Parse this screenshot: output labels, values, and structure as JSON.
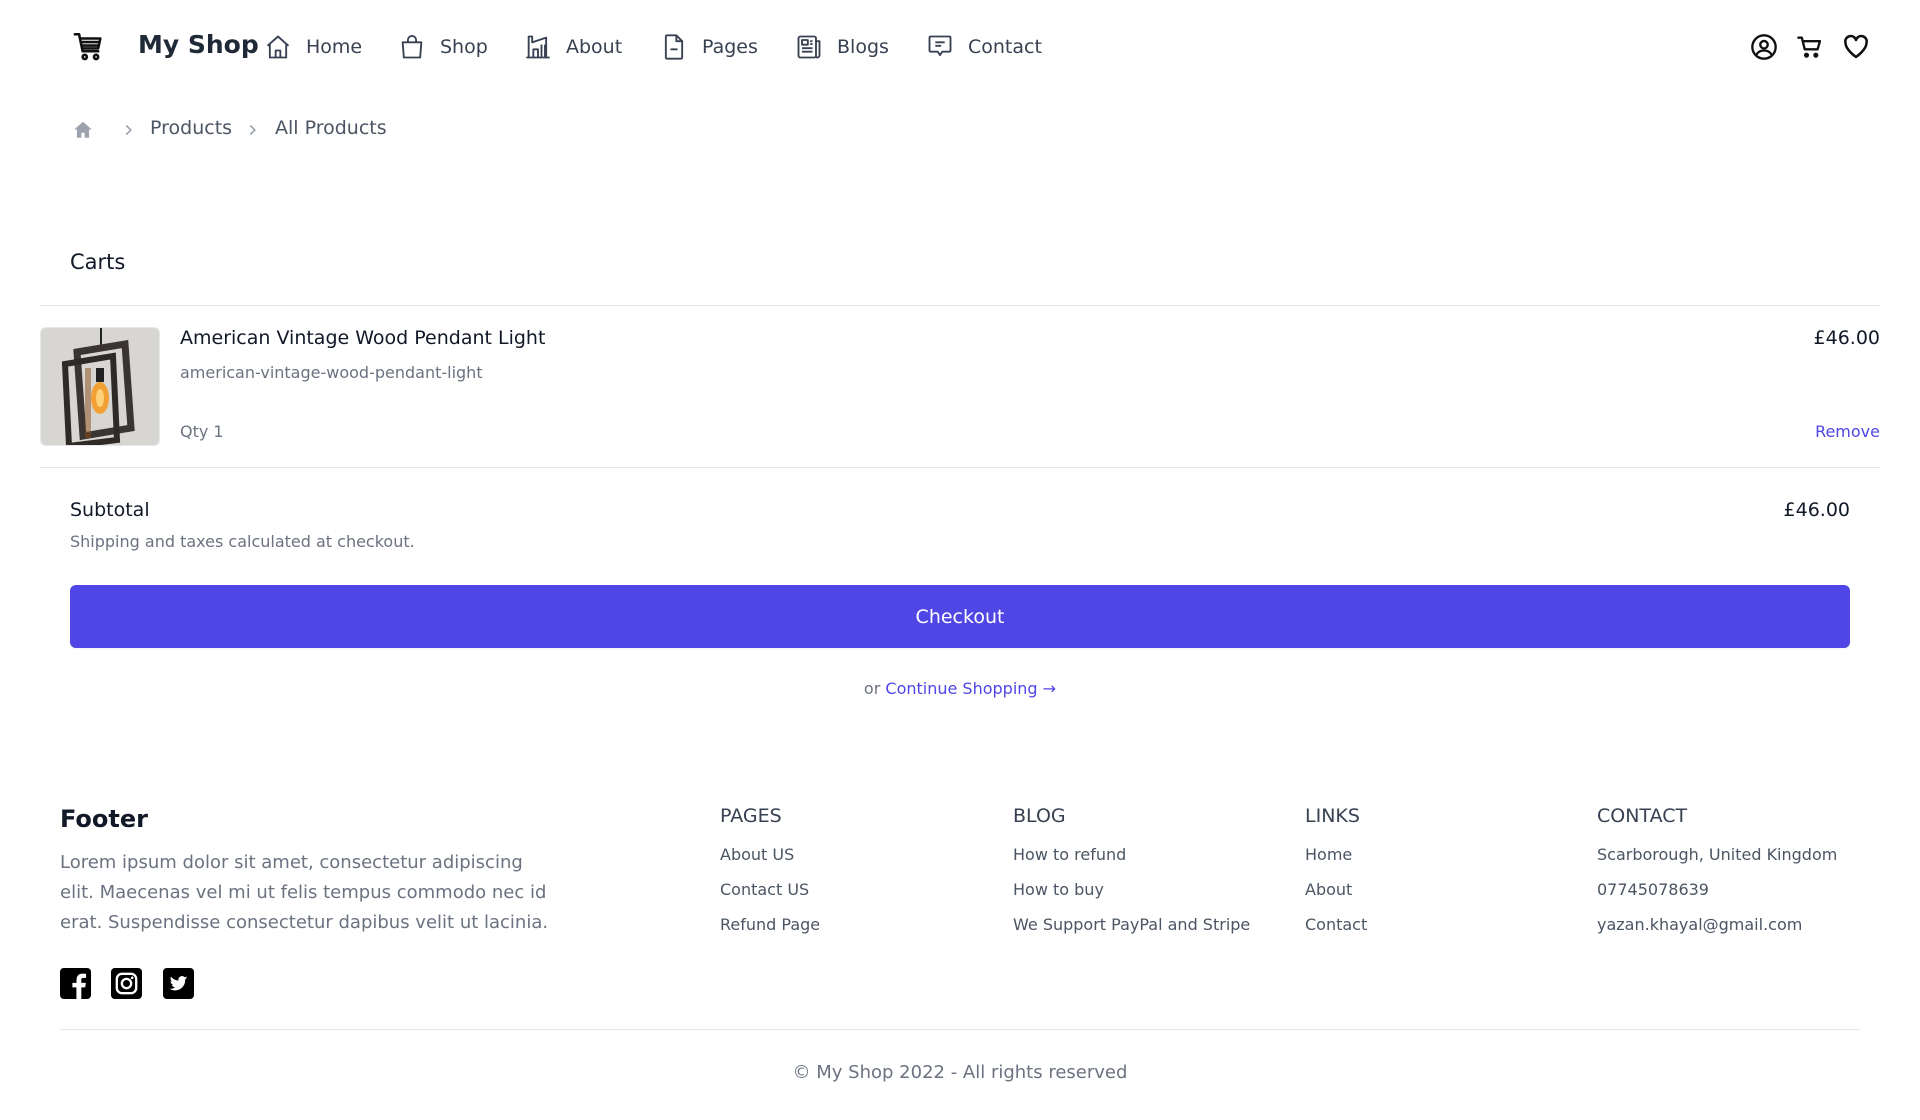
{
  "header": {
    "brand": "My Shop",
    "nav": [
      {
        "label": "Home",
        "icon": "home-icon"
      },
      {
        "label": "Shop",
        "icon": "shopping-bag-icon"
      },
      {
        "label": "About",
        "icon": "building-icon"
      },
      {
        "label": "Pages",
        "icon": "document-icon"
      },
      {
        "label": "Blogs",
        "icon": "newspaper-icon"
      },
      {
        "label": "Contact",
        "icon": "chat-bubble-icon"
      }
    ],
    "actions": [
      "user-account-icon",
      "cart-icon",
      "wishlist-heart-icon"
    ]
  },
  "breadcrumb": {
    "home_icon": "home-icon",
    "items": [
      "Products",
      "All Products"
    ]
  },
  "cart": {
    "title": "Carts",
    "items": [
      {
        "name": "American Vintage Wood Pendant Light",
        "slug": "american-vintage-wood-pendant-light",
        "qty_label": "Qty 1",
        "price": "£46.00",
        "remove_label": "Remove"
      }
    ],
    "subtotal_label": "Subtotal",
    "subtotal_value": "£46.00",
    "shipping_note": "Shipping and taxes calculated at checkout.",
    "checkout_label": "Checkout",
    "continue_prefix": "or",
    "continue_label": "Continue Shopping →"
  },
  "footer": {
    "title": "Footer",
    "description": "Lorem ipsum dolor sit amet, consectetur adipiscing elit. Maecenas vel mi ut felis tempus commodo nec id erat. Suspendisse consectetur dapibus velit ut lacinia.",
    "socials": [
      "facebook-icon",
      "instagram-icon",
      "twitter-icon"
    ],
    "columns": [
      {
        "heading": "PAGES",
        "links": [
          "About US",
          "Contact US",
          "Refund Page"
        ]
      },
      {
        "heading": "BLOG",
        "links": [
          "How to refund",
          "How to buy",
          "We Support PayPal and Stripe"
        ]
      },
      {
        "heading": "LINKS",
        "links": [
          "Home",
          "About",
          "Contact"
        ]
      },
      {
        "heading": "CONTACT",
        "links": [
          "Scarborough, United Kingdom",
          "07745078639",
          "yazan.khayal@gmail.com"
        ]
      }
    ],
    "copyright": "© My Shop 2022 - All rights reserved"
  },
  "colors": {
    "accent": "#4f46e5",
    "text": "#111827",
    "muted": "#6b7280",
    "divider": "#e5e7eb"
  }
}
